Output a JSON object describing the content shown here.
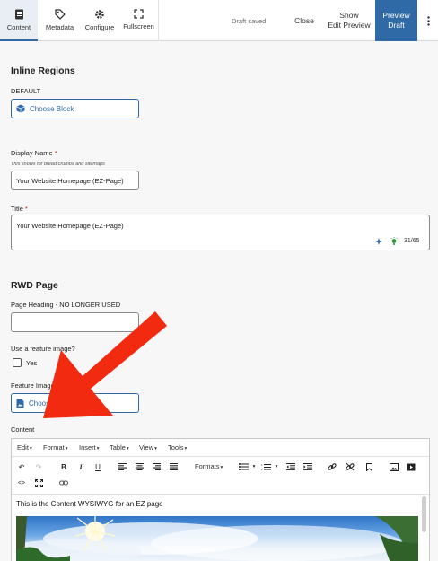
{
  "toolbar": {
    "content_label": "Content",
    "metadata_label": "Metadata",
    "configure_label": "Configure",
    "fullscreen_label": "Fullscreen",
    "draft_status": "Draft saved",
    "close_label": "Close",
    "show_label_1": "Show",
    "show_label_2": "Edit Preview",
    "preview_label_1": "Preview",
    "preview_label_2": "Draft"
  },
  "form": {
    "inline_regions_title": "Inline Regions",
    "default_label": "DEFAULT",
    "choose_block_label": "Choose Block",
    "display_name_label": "Display Name",
    "display_name_hint": "This shows for bread crumbs and sitemaps",
    "display_name_value": "Your Website Homepage (EZ-Page)",
    "title_label": "Title",
    "title_value": "Your Website Homepage (EZ-Page)",
    "title_counter": "31/65",
    "rwd_page_title": "RWD Page",
    "page_heading_label": "Page Heading - NO LONGER USED",
    "page_heading_value": "",
    "feature_question": "Use a feature image?",
    "yes_label": "Yes",
    "feature_image_label": "Feature Image",
    "choose_image_label": "Choose",
    "content_label": "Content"
  },
  "editor": {
    "menus": [
      "Edit",
      "Format",
      "Insert",
      "Table",
      "View",
      "Tools"
    ],
    "formats_label": "Formats",
    "body_text": "This is the Content WYSIWYG for an EZ page"
  },
  "colors": {
    "accent": "#2f6aa6",
    "annotation_arrow": "#f22b10",
    "required": "#c4161c"
  }
}
